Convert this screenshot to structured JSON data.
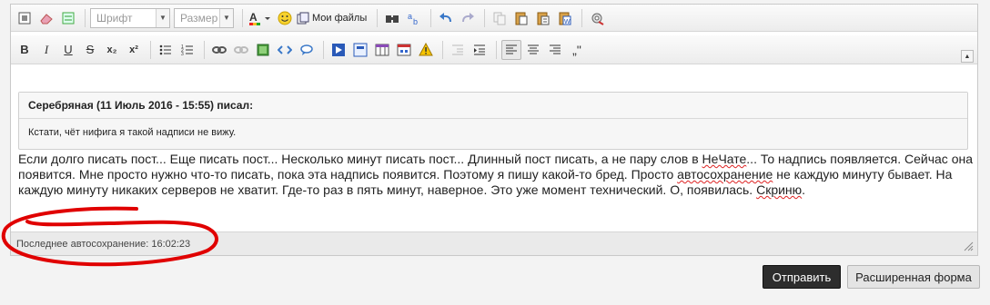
{
  "toolbar_top": {
    "font_select": "Шрифт",
    "size_select": "Размер",
    "my_files_label": "Мои файлы"
  },
  "toolbar_bottom": {
    "bold": "B",
    "italic": "I",
    "underline": "U",
    "strike": "S",
    "subscript": "x₂",
    "superscript": "x²",
    "quote_mark": "„\""
  },
  "quote": {
    "header": "Серебряная (11 Июль 2016 - 15:55) писал:",
    "body": "Кстати, чёт нифига я такой надписи не вижу."
  },
  "post": {
    "part1": "Если долго писать пост... Еще писать пост... Несколько минут писать пост... Длинный пост писать, а не пару слов в ",
    "spell1": "НеЧате",
    "part2": "... То надпись появляется. Сейчас она появится. Мне просто нужно что-то писать, пока эта надпись появится. Поэтому я пишу какой-то бред. Просто ",
    "spell2": "автосохранение",
    "part3": " не каждую минуту бывает. На каждую минуту никаких серверов не хватит. Где-то раз в пять минут, наверное. Это уже момент технический. О, появилась. ",
    "spell3": "Скриню",
    "part4": "."
  },
  "status": {
    "autosave": "Последнее автосохранение: 16:02:23"
  },
  "buttons": {
    "send": "Отправить",
    "advanced": "Расширенная форма"
  },
  "colors": {
    "annotation_red": "#e00000",
    "send_bg": "#2d2d2d"
  }
}
